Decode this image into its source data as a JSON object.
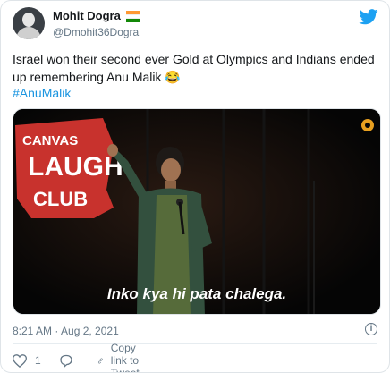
{
  "author": {
    "name": "Mohit Dogra",
    "handle": "@Dmohit36Dogra",
    "flag_colors": [
      "#ff9933",
      "#ffffff",
      "#138808"
    ]
  },
  "tweet": {
    "text": "Israel won their second ever Gold at Olympics and Indians ended up remembering Anu Malik 😂",
    "hashtag": "#AnuMalik"
  },
  "media": {
    "venue_sign": [
      "CANVAS",
      "LAUGH",
      "CLUB"
    ],
    "caption": "Inko kya hi pata chalega."
  },
  "footer": {
    "timestamp": "8:21 AM · Aug 2, 2021",
    "likes": "1",
    "copy_link": "Copy link to Tweet"
  },
  "colors": {
    "link": "#1b95e0",
    "twitter_blue": "#1da1f2",
    "like_red": "#e0245e",
    "muted": "#657786"
  }
}
